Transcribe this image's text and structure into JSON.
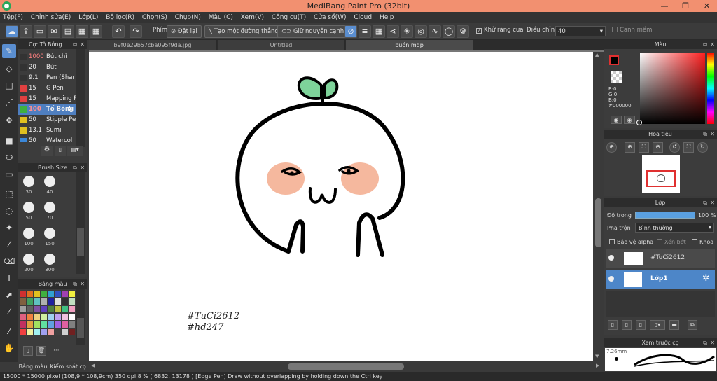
{
  "window": {
    "title": "MediBang Paint Pro (32bit)",
    "min": "—",
    "max": "❐",
    "close": "✕"
  },
  "menu": [
    "Tệp(F)",
    "Chỉnh sửa(E)",
    "Lớp(L)",
    "Bộ lọc(R)",
    "Chọn(S)",
    "Chụp(N)",
    "Màu (C)",
    "Xem(V)",
    "Công cụ(T)",
    "Cửa sổ(W)",
    "Cloud",
    "Help"
  ],
  "toolbar": {
    "phim_label": "Phím",
    "reset_label": "Đặt lại",
    "straight_label": "Tạo một đường thẳng",
    "keep_edge_label": "Giữ nguyên cạnh",
    "antialias_label": "Khử răng cưa",
    "adjust_label": "Điều chỉnh",
    "adjust_value": "40",
    "smooth_label": "Canh mềm"
  },
  "brush_panel": {
    "title": "Cọ: Tô Bóng",
    "items": [
      {
        "size": "1000",
        "name": "Bút chì",
        "color": "#333333"
      },
      {
        "size": "20",
        "name": "Bút",
        "color": "#333333"
      },
      {
        "size": "9.1",
        "name": "Pen (Shar",
        "color": "#333333"
      },
      {
        "size": "15",
        "name": "G Pen",
        "color": "#e04040"
      },
      {
        "size": "15",
        "name": "Mapping P",
        "color": "#e04040"
      },
      {
        "size": "100",
        "name": "Tố Bóng",
        "color": "#3fb03f"
      },
      {
        "size": "50",
        "name": "Stipple Pe",
        "color": "#e0c020"
      },
      {
        "size": "13.1",
        "name": "Sumi",
        "color": "#e0c020"
      },
      {
        "size": "50",
        "name": "Watercol",
        "color": "#3b87d8"
      }
    ]
  },
  "brush_size_panel": {
    "title": "Brush Size",
    "sizes": [
      "30",
      "40",
      "50",
      "70",
      "100",
      "150",
      "200",
      "300"
    ]
  },
  "palette_panel": {
    "title": "Bảng màu",
    "more": "···",
    "tab1": "Bảng màu",
    "tab2": "Kiểm soát cọ"
  },
  "tabs": [
    "b9f0e29b57cba095f9da.jpg",
    "Untitled",
    "buồn.mdp"
  ],
  "canvas": {
    "hashtag1": "#TuCi2612",
    "hashtag2": "#hd247"
  },
  "color_panel": {
    "title": "Màu",
    "r": "R:0",
    "g": "G:0",
    "b": "B:0",
    "hex": "#000000"
  },
  "navigator_panel": {
    "title": "Hoa tiêu"
  },
  "layer_panel": {
    "title": "Lớp",
    "opacity_label": "Độ trong",
    "opacity_value": "100 %",
    "blend_label": "Pha trộn",
    "blend_value": "Bình thường",
    "protect_alpha": "Bảo vệ alpha",
    "clip": "Xén bớt",
    "lock": "Khóa",
    "layers": [
      {
        "name": "#TuCi2612"
      },
      {
        "name": "Lớp1"
      }
    ]
  },
  "preview_panel": {
    "title": "Xem trước cọ",
    "size": "7.26mm"
  },
  "status": {
    "text": "15000 * 15000 pixel   (108,9 * 108,9cm)   350 dpi   8 %   ( 6832, 13178 )   [Edge Pen] Draw without overlapping by holding down the Ctrl key"
  },
  "colors": {
    "accent": "#5a8ed0",
    "titlebar": "#f29070",
    "cheek": "#f5b89e",
    "sprout": "#7ed39a"
  }
}
